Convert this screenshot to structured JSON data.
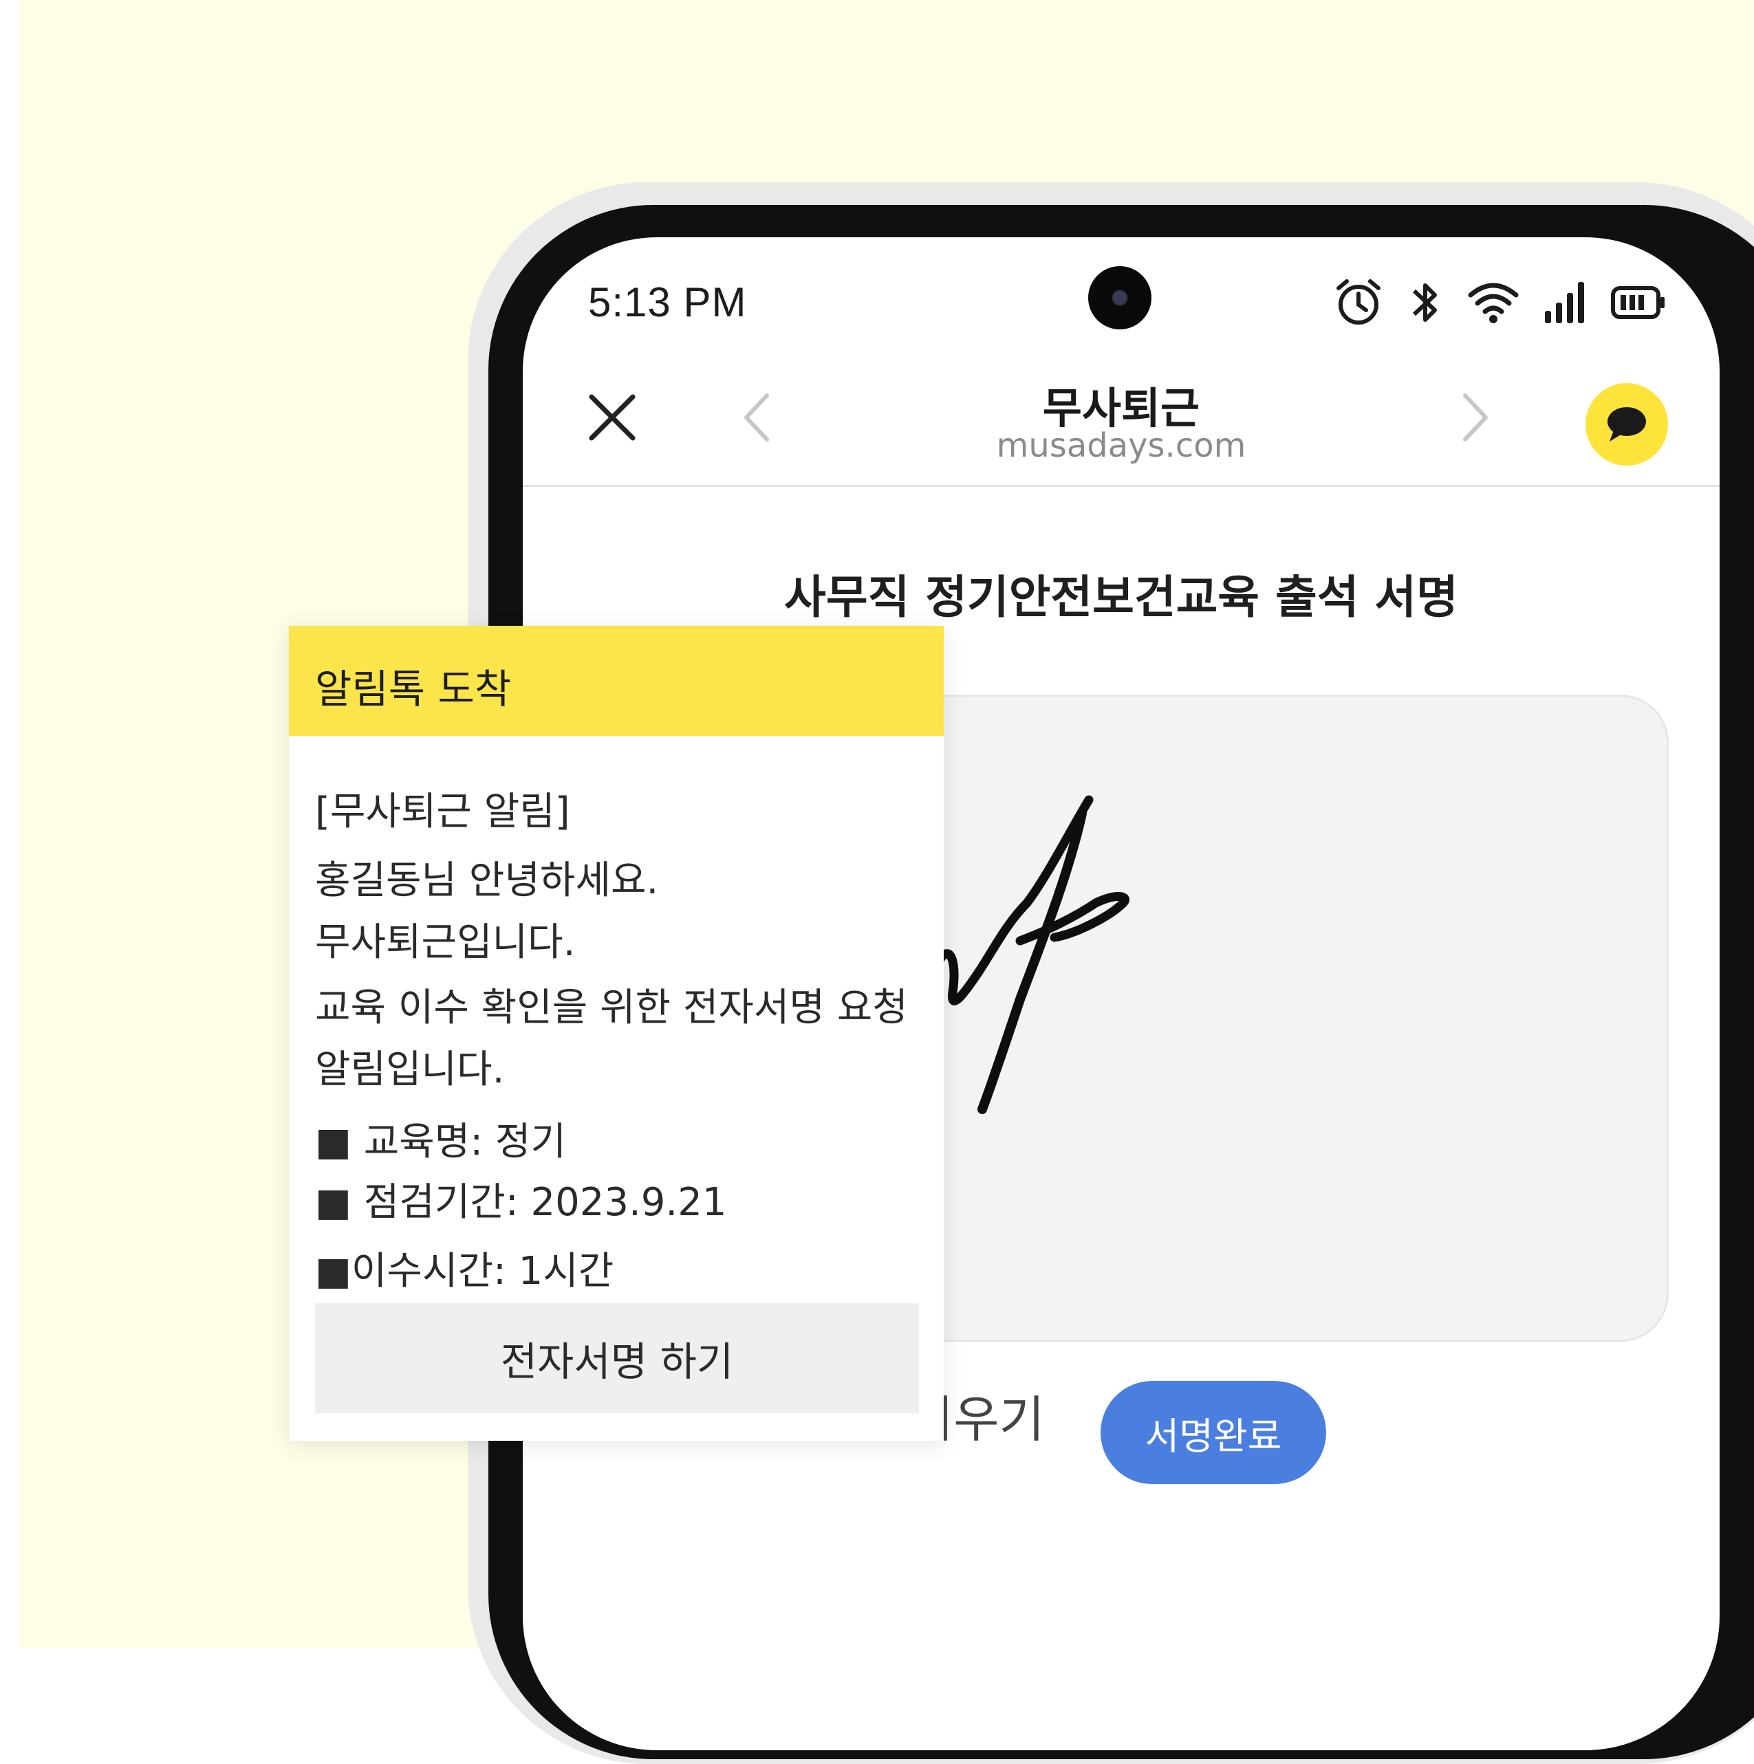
{
  "status_bar": {
    "time": "5:13 PM",
    "icons": [
      "alarm-icon",
      "bluetooth-icon",
      "wifi-icon",
      "signal-icon",
      "battery-icon"
    ]
  },
  "nav": {
    "title": "무사퇴근",
    "url": "musadays.com",
    "icons": [
      "close-icon",
      "chevron-left-icon",
      "chevron-right-icon",
      "kakaotalk-icon"
    ]
  },
  "page": {
    "title": "사무직 정기안전보건교육 출석 서명",
    "clear_label": "지우기",
    "done_label": "서명완료"
  },
  "notification": {
    "header": "알림톡 도착",
    "lines": [
      "[무사퇴근 알림]",
      "홍길동님 안녕하세요.",
      "무사퇴근입니다.",
      "교육 이수 확인을 위한 전자서명 요청",
      "알림입니다.",
      "■ 교육명: 정기",
      "■ 점검기간: 2023.9.21",
      "■이수시간: 1시간"
    ],
    "button_label": "전자서명 하기"
  },
  "colors": {
    "background": "#fefde6",
    "notification_header": "#fbe54b",
    "kakao_yellow": "#fee33a",
    "done_button": "#4a7fe0"
  }
}
